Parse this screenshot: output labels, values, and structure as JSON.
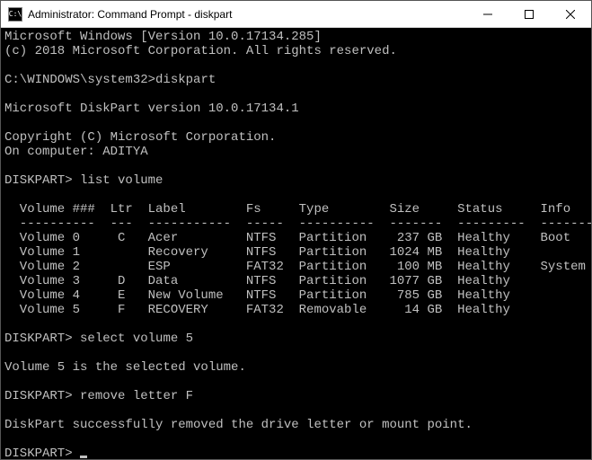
{
  "titlebar": {
    "title": "Administrator: Command Prompt - diskpart"
  },
  "terminal": {
    "line1": "Microsoft Windows [Version 10.0.17134.285]",
    "line2": "(c) 2018 Microsoft Corporation. All rights reserved.",
    "prompt1": "C:\\WINDOWS\\system32>",
    "cmd1": "diskpart",
    "line4": "Microsoft DiskPart version 10.0.17134.1",
    "line5": "Copyright (C) Microsoft Corporation.",
    "line6": "On computer: ADITYA",
    "prompt2": "DISKPART>",
    "cmd2": " list volume",
    "tableHeader": "  Volume ###  Ltr  Label        Fs     Type        Size     Status     Info",
    "tableDivider": "  ----------  ---  -----------  -----  ----------  -------  ---------  --------",
    "volumes": [
      {
        "row": "  Volume 0     C   Acer         NTFS   Partition    237 GB  Healthy    Boot"
      },
      {
        "row": "  Volume 1         Recovery     NTFS   Partition   1024 MB  Healthy"
      },
      {
        "row": "  Volume 2         ESP          FAT32  Partition    100 MB  Healthy    System"
      },
      {
        "row": "  Volume 3     D   Data         NTFS   Partition   1077 GB  Healthy"
      },
      {
        "row": "  Volume 4     E   New Volume   NTFS   Partition    785 GB  Healthy"
      },
      {
        "row": "  Volume 5     F   RECOVERY     FAT32  Removable     14 GB  Healthy"
      }
    ],
    "prompt3": "DISKPART>",
    "cmd3": " select volume 5",
    "line_selected": "Volume 5 is the selected volume.",
    "prompt4": "DISKPART>",
    "cmd4": " remove letter F",
    "line_removed": "DiskPart successfully removed the drive letter or mount point.",
    "prompt5": "DISKPART>"
  }
}
